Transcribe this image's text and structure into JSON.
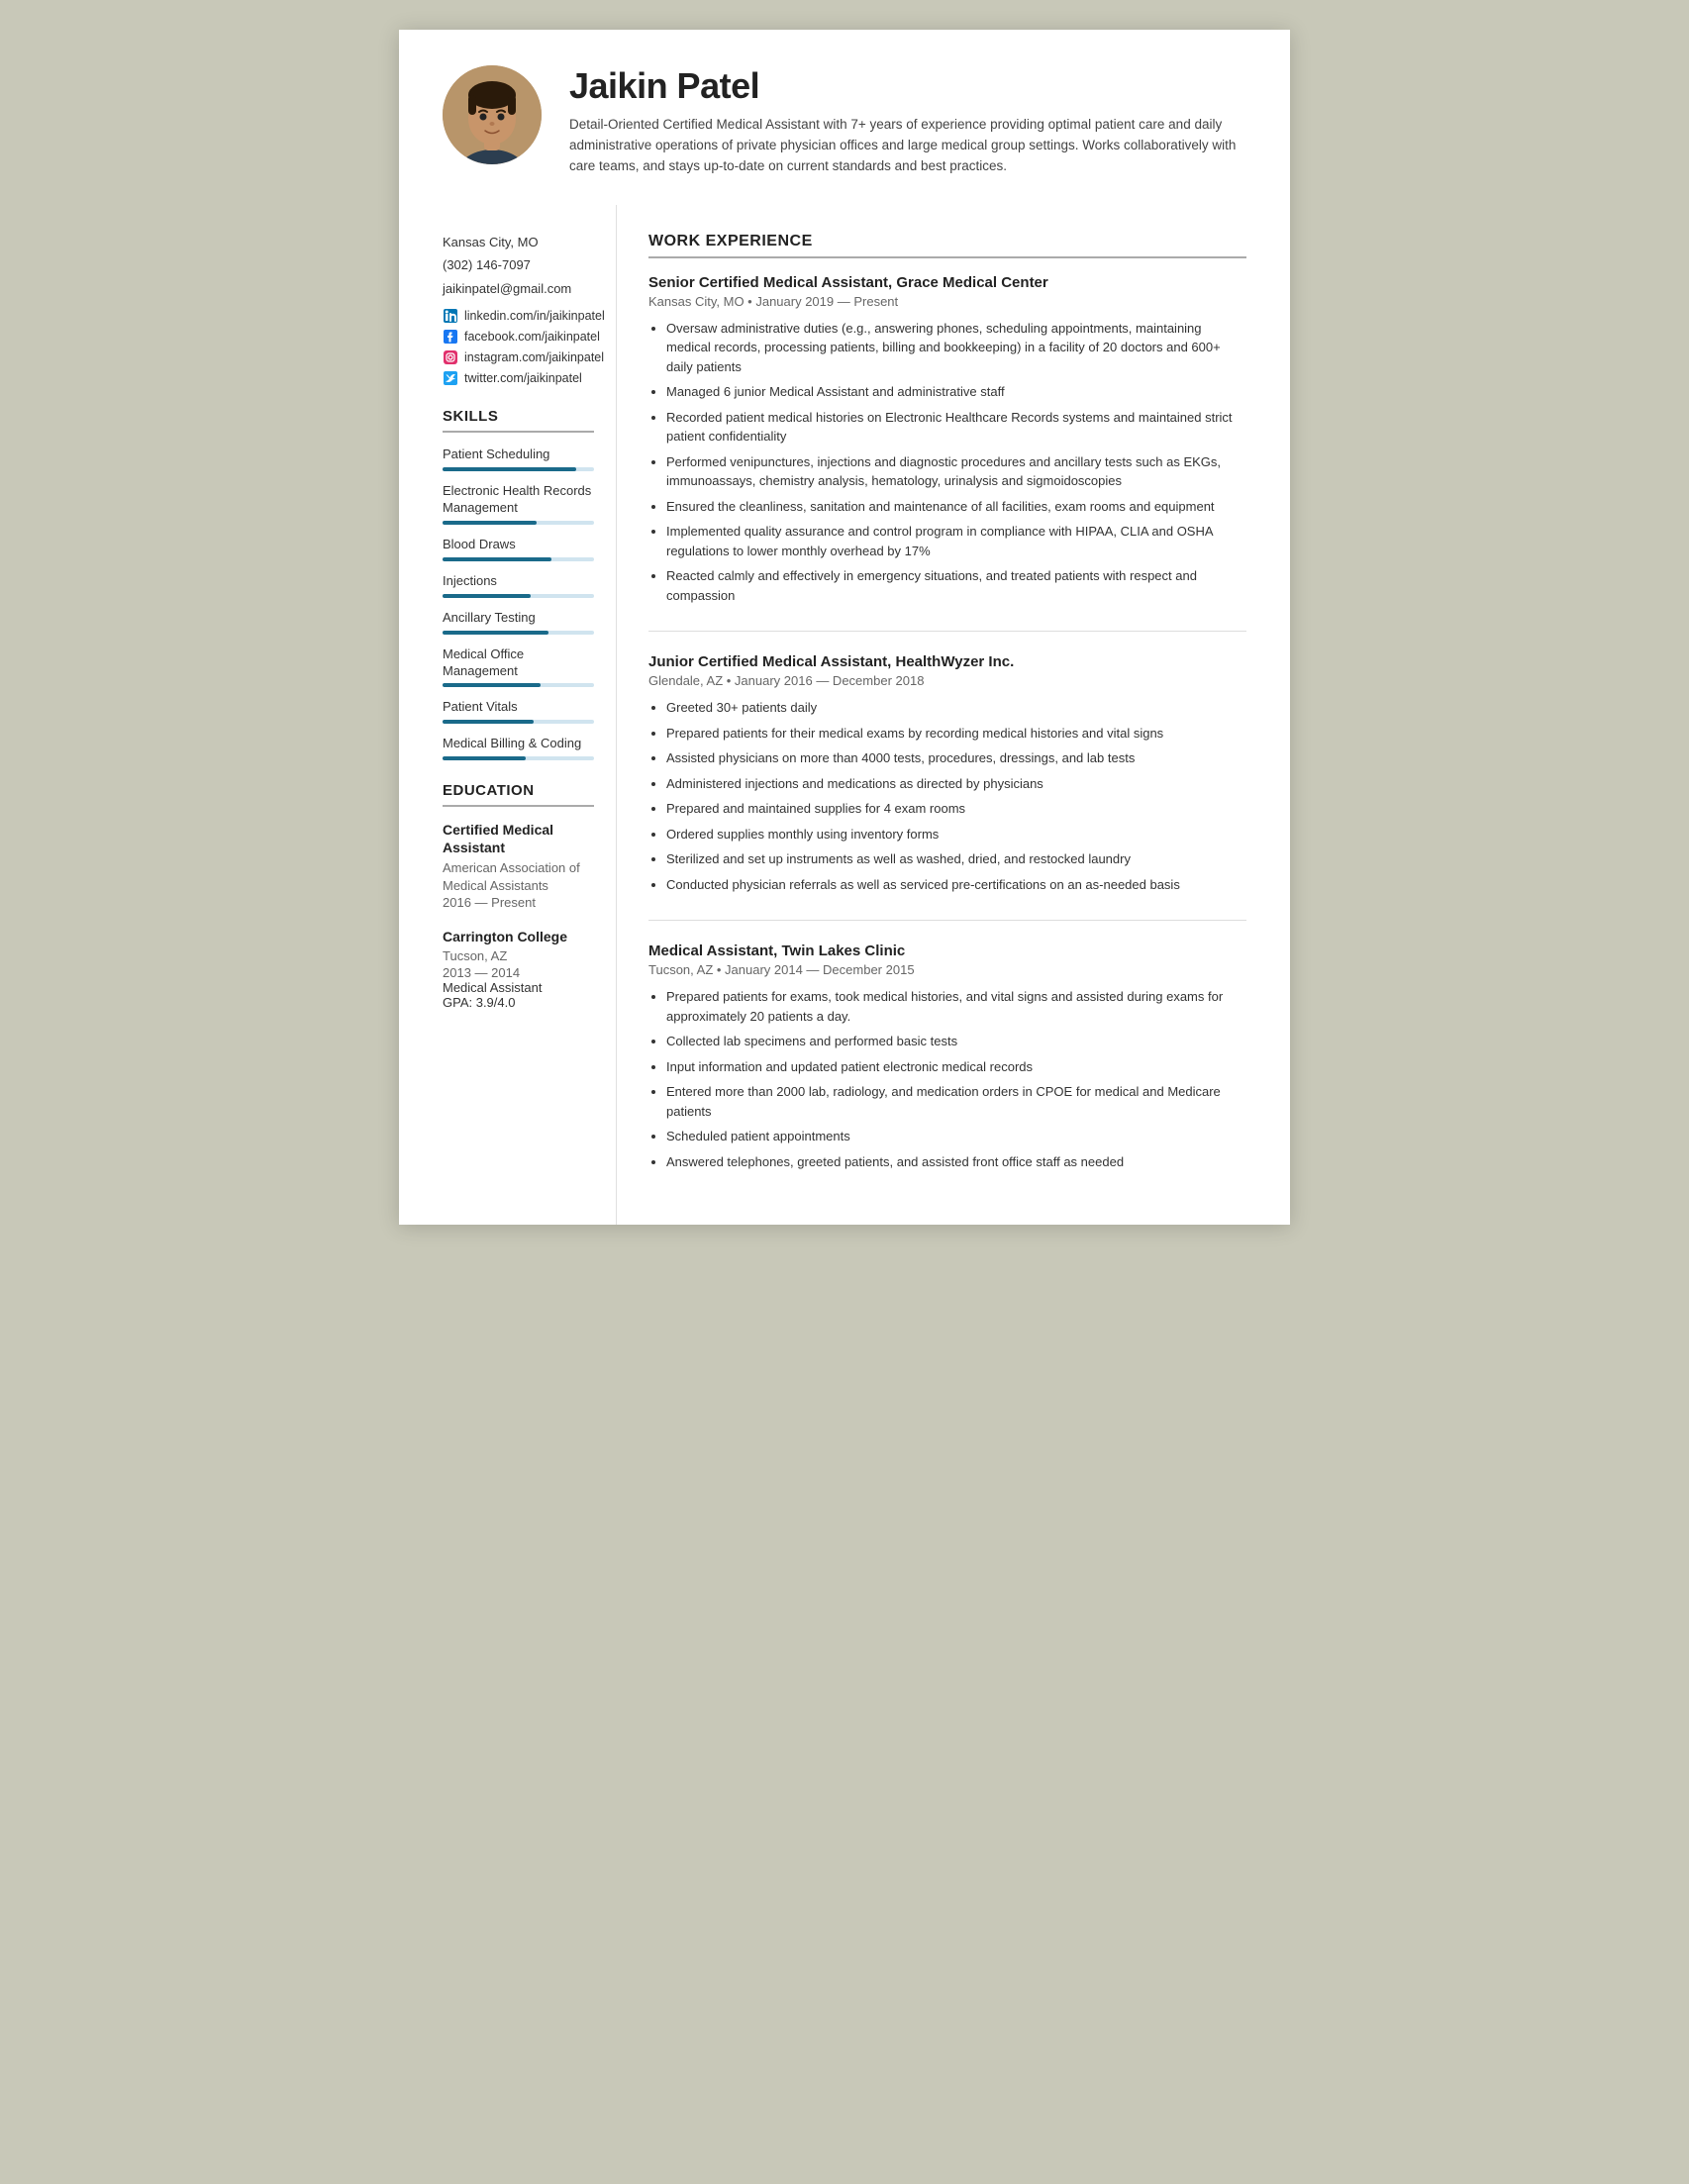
{
  "header": {
    "name": "Jaikin Patel",
    "summary": "Detail-Oriented Certified Medical Assistant with 7+ years of experience providing optimal patient care and daily administrative operations of private physician offices and large medical group settings. Works collaboratively with care teams, and stays up-to-date on current standards and best practices."
  },
  "contact": {
    "location": "Kansas City, MO",
    "phone": "(302) 146-7097",
    "email": "jaikinpatel@gmail.com",
    "linkedin": "linkedin.com/in/jaikinpatel",
    "facebook": "facebook.com/jaikinpatel",
    "instagram": "instagram.com/jaikinpatel",
    "twitter": "twitter.com/jaikinpatel"
  },
  "skills": {
    "heading": "SKILLS",
    "items": [
      {
        "name": "Patient Scheduling",
        "fill_pct": 88
      },
      {
        "name": "Electronic Health Records Management",
        "fill_pct": 62
      },
      {
        "name": "Blood Draws",
        "fill_pct": 72
      },
      {
        "name": "Injections",
        "fill_pct": 58
      },
      {
        "name": "Ancillary Testing",
        "fill_pct": 70
      },
      {
        "name": "Medical Office Management",
        "fill_pct": 65
      },
      {
        "name": "Patient Vitals",
        "fill_pct": 60
      },
      {
        "name": "Medical Billing & Coding",
        "fill_pct": 55
      }
    ]
  },
  "education": {
    "heading": "EDUCATION",
    "items": [
      {
        "degree": "Certified Medical Assistant",
        "school": "American Association of Medical Assistants",
        "year": "2016 — Present",
        "detail": "",
        "gpa": ""
      },
      {
        "degree": "Carrington College",
        "school": "Tucson, AZ",
        "year": "2013 — 2014",
        "detail": "Medical Assistant",
        "gpa": "GPA: 3.9/4.0"
      }
    ]
  },
  "work": {
    "heading": "WORK EXPERIENCE",
    "jobs": [
      {
        "title": "Senior Certified Medical Assistant, Grace Medical Center",
        "meta": "Kansas City, MO • January 2019 — Present",
        "bullets": [
          "Oversaw administrative duties (e.g., answering phones, scheduling appointments, maintaining medical records, processing patients, billing and bookkeeping) in a facility of 20 doctors and 600+ daily patients",
          "Managed 6 junior Medical Assistant and administrative staff",
          "Recorded patient medical histories on Electronic Healthcare Records systems and maintained strict patient confidentiality",
          "Performed venipunctures, injections and diagnostic procedures and ancillary tests such as EKGs, immunoassays, chemistry analysis, hematology, urinalysis and sigmoidoscopies",
          "Ensured the cleanliness, sanitation and maintenance of all facilities, exam rooms and equipment",
          "Implemented quality assurance and control program in compliance with HIPAA, CLIA and OSHA regulations to lower monthly overhead by 17%",
          "Reacted calmly and effectively in emergency situations, and treated patients with respect and compassion"
        ]
      },
      {
        "title": "Junior Certified Medical Assistant, HealthWyzer Inc.",
        "meta": "Glendale, AZ • January 2016 — December 2018",
        "bullets": [
          "Greeted 30+ patients daily",
          "Prepared patients for their medical exams by recording medical histories and vital signs",
          "Assisted physicians on more than 4000 tests, procedures, dressings, and lab tests",
          "Administered injections and medications as directed by physicians",
          "Prepared and maintained supplies for 4 exam rooms",
          "Ordered supplies monthly using inventory forms",
          "Sterilized and set up instruments as well as washed, dried, and restocked laundry",
          "Conducted physician referrals as well as serviced pre-certifications on an as-needed basis"
        ]
      },
      {
        "title": "Medical Assistant, Twin Lakes Clinic",
        "meta": "Tucson, AZ • January 2014 — December 2015",
        "bullets": [
          "Prepared patients for exams, took medical histories, and vital signs and assisted during exams for approximately 20 patients a day.",
          "Collected lab specimens and performed basic tests",
          "Input information and updated patient electronic medical records",
          "Entered more than 2000 lab, radiology, and medication orders in CPOE for medical and Medicare patients",
          "Scheduled patient appointments",
          "Answered telephones, greeted patients, and assisted front office staff as needed"
        ]
      }
    ]
  }
}
